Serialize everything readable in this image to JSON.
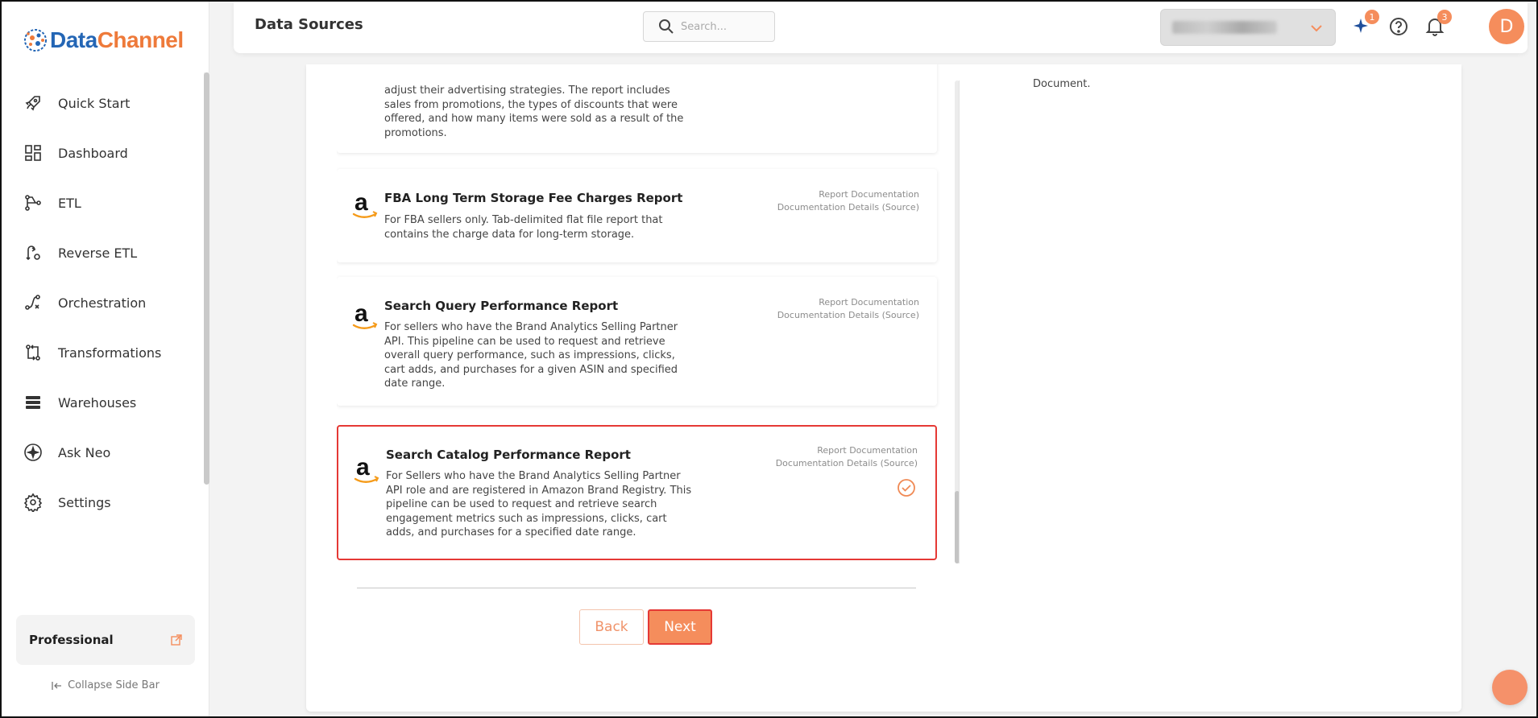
{
  "brand": {
    "name_part1": "Data",
    "name_part2": "Channel"
  },
  "sidebar": {
    "items": [
      {
        "label": "Quick Start",
        "icon": "rocket-icon"
      },
      {
        "label": "Dashboard",
        "icon": "dashboard-icon"
      },
      {
        "label": "ETL",
        "icon": "etl-icon"
      },
      {
        "label": "Reverse ETL",
        "icon": "reverse-etl-icon"
      },
      {
        "label": "Orchestration",
        "icon": "orchestration-icon"
      },
      {
        "label": "Transformations",
        "icon": "transformations-icon"
      },
      {
        "label": "Warehouses",
        "icon": "warehouses-icon"
      },
      {
        "label": "Ask Neo",
        "icon": "ask-neo-icon"
      },
      {
        "label": "Settings",
        "icon": "gear-icon"
      }
    ],
    "plan": "Professional",
    "collapse_label": "Collapse Side Bar"
  },
  "header": {
    "title": "Data Sources",
    "search_placeholder": "Search...",
    "ai_badge": "1",
    "notifications_badge": "3",
    "avatar_initial": "D"
  },
  "reports": {
    "partial_desc": "adjust their advertising strategies. The report includes sales from promotions, the types of discounts that were offered, and how many items were sold as a result of the promotions.",
    "items": [
      {
        "title": "FBA Long Term Storage Fee Charges Report",
        "desc": "For FBA sellers only. Tab-delimited flat file report that contains the charge data for long-term storage.",
        "link1": "Report Documentation",
        "link2": "Documentation Details (Source)"
      },
      {
        "title": "Search Query Performance Report",
        "desc": "For sellers who have the Brand Analytics Selling Partner API. This pipeline can be used to request and retrieve overall query performance, such as impressions, clicks, cart adds, and purchases for a given ASIN and specified date range.",
        "link1": "Report Documentation",
        "link2": "Documentation Details (Source)"
      },
      {
        "title": "Search Catalog Performance Report",
        "desc": "For Sellers who have the Brand Analytics Selling Partner API role and are registered in Amazon Brand Registry. This pipeline can be used to request and retrieve search engagement metrics such as impressions, clicks, cart adds, and purchases for a specified date range.",
        "link1": "Report Documentation",
        "link2": "Documentation Details (Source)",
        "selected": true
      }
    ]
  },
  "right_panel_text": "Document.",
  "buttons": {
    "back": "Back",
    "next": "Next"
  },
  "colors": {
    "accent": "#f58d5c",
    "brand_blue": "#2466b5",
    "selected_border": "#e53935"
  }
}
